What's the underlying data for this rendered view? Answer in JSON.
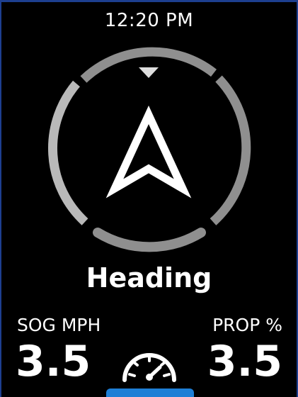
{
  "status": {
    "time": "12:20 PM"
  },
  "compass": {
    "ring_color": "#8f8f8f",
    "ring_light_color": "#b8b8b8",
    "pointer_color": "#ffffff",
    "icon": "heading-arrow-icon",
    "marker_icon": "north-marker-icon"
  },
  "main": {
    "title": "Heading"
  },
  "stats": {
    "sog": {
      "label": "SOG MPH",
      "value": "3.5"
    },
    "prop": {
      "label": "PROP %",
      "value": "3.5"
    }
  },
  "controls": {
    "gauge_icon": "speedometer-icon",
    "tab_color": "#1e7fd6"
  }
}
